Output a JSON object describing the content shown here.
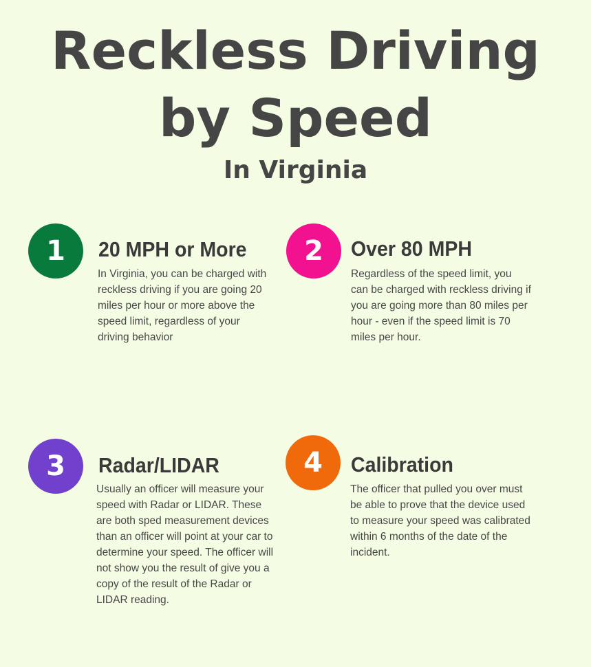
{
  "title": {
    "line1": "Reckless Driving",
    "line2": "by Speed",
    "subtitle": "In Virginia"
  },
  "colors": {
    "background": "#f4fce3",
    "text": "#454545",
    "item1": "#087a3c",
    "item2": "#f2118e",
    "item3": "#7140cc",
    "item4": "#f06a0c"
  },
  "items": [
    {
      "number": "1",
      "heading": "20 MPH or More",
      "text": "In Virginia, you can be charged with reckless driving if you are going 20 miles per hour or more above the speed limit, regardless of your driving behavior"
    },
    {
      "number": "2",
      "heading": "Over 80 MPH",
      "text": "Regardless of the speed limit, you can be charged with reckless driving if you are going more than 80 miles per hour - even if the speed limit is 70 miles per hour."
    },
    {
      "number": "3",
      "heading": "Radar/LIDAR",
      "text": "Usually an officer will measure your speed with Radar or LIDAR. These are both sped measurement devices than an officer will point at your car to determine your speed. The officer will not show you the result of give you a copy of the result of the Radar or LIDAR reading."
    },
    {
      "number": "4",
      "heading": "Calibration",
      "text": "The officer that pulled you over must be able to prove that the device used to measure your speed was calibrated within 6 months of the date of the incident."
    }
  ]
}
